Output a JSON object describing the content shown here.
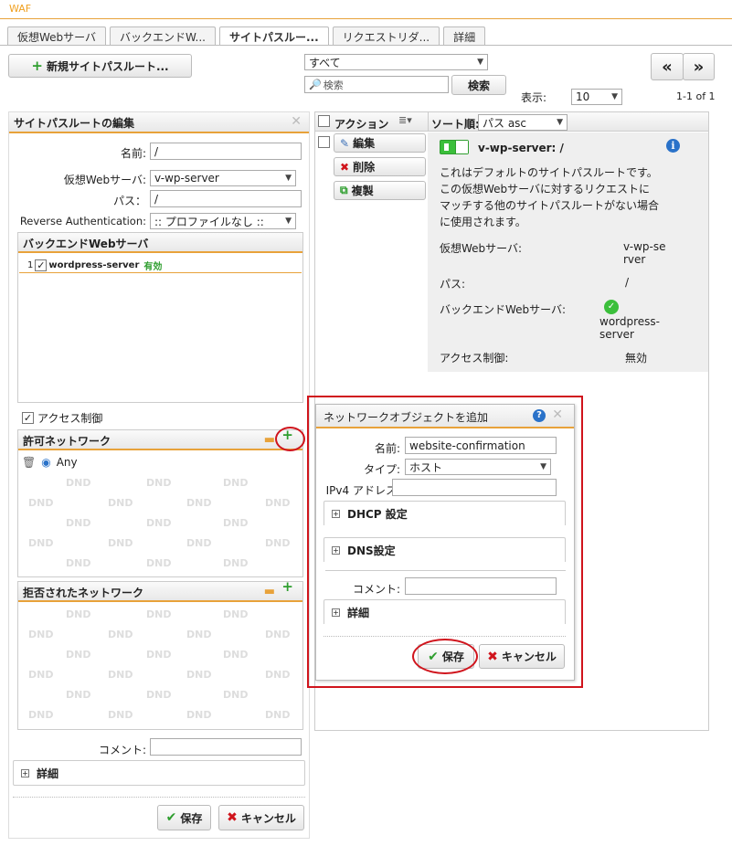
{
  "app": {
    "title": "WAF"
  },
  "tabs": [
    {
      "label": "仮想Webサーバ"
    },
    {
      "label": "バックエンドW..."
    },
    {
      "label": "サイトパスルー..."
    },
    {
      "label": "リクエストリダ..."
    },
    {
      "label": "詳細"
    }
  ],
  "toolbar": {
    "new_button": "新規サイトパスルート...",
    "filter_value": "すべて",
    "search_placeholder": "検索",
    "search_button": "検索",
    "display_label": "表示:",
    "display_value": "10",
    "page_info": "1-1 of 1",
    "prev": "«",
    "next": "»"
  },
  "edit_panel": {
    "title": "サイトパスルートの編集",
    "name_label": "名前:",
    "name_value": "/",
    "vserver_label": "仮想Webサーバ:",
    "vserver_value": "v-wp-server",
    "path_label": "パス：",
    "path_value": "/",
    "reverse_auth_label": "Reverse Authentication:",
    "reverse_auth_value": ":: プロファイルなし ::",
    "backend_header": "バックエンドWebサーバ",
    "backend_items": [
      {
        "index": "1",
        "name": "wordpress-server",
        "status": "有効"
      }
    ],
    "access_control_label": "アクセス制御",
    "allowed_header": "許可ネットワーク",
    "allowed_items": [
      {
        "name": "Any"
      }
    ],
    "denied_header": "拒否されたネットワーク",
    "dnd": "DND",
    "comment_label": "コメント:",
    "details_label": "詳細",
    "save": "保存",
    "cancel": "キャンセル"
  },
  "list": {
    "action_header": "アクション",
    "sort_label": "ソート順:",
    "sort_value": "パス asc",
    "actions": {
      "edit": "編集",
      "delete": "削除",
      "clone": "複製"
    },
    "item": {
      "title": "v-wp-server: /",
      "description": "これはデフォルトのサイトパスルートです。この仮想Webサーバに対するリクエストにマッチする他のサイトパスルートがない場合に使用されます。",
      "fields": [
        {
          "label": "仮想Webサーバ:",
          "value": "v-wp-server"
        },
        {
          "label": "パス:",
          "value": "/"
        },
        {
          "label": "バックエンドWebサーバ:",
          "value": "wordpress-server"
        },
        {
          "label": "アクセス制御:",
          "value": "無効"
        }
      ]
    }
  },
  "dialog": {
    "title": "ネットワークオブジェクトを追加",
    "name_label": "名前:",
    "name_value": "website-confirmation",
    "type_label": "タイプ:",
    "type_value": "ホスト",
    "ipv4_label": "IPv4 アドレス:",
    "ipv4_value": "",
    "dhcp_label": "DHCP 設定",
    "dns_label": "DNS設定",
    "comment_label": "コメント:",
    "comment_value": "",
    "details_label": "詳細",
    "save": "保存",
    "cancel": "キャンセル"
  },
  "colors": {
    "accent": "#e8a23a",
    "highlight": "#d0141c",
    "ok": "#2e9e2e",
    "info": "#2a72c9"
  }
}
